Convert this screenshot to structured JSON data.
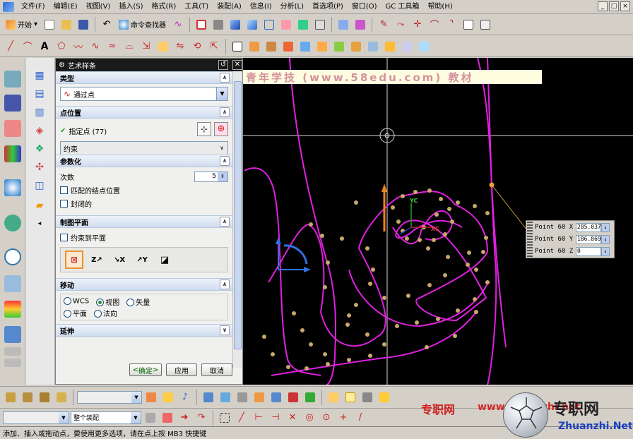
{
  "menubar": {
    "items": [
      "文件(F)",
      "编辑(E)",
      "视图(V)",
      "插入(S)",
      "格式(R)",
      "工具(T)",
      "装配(A)",
      "信息(I)",
      "分析(L)",
      "首选项(P)",
      "窗口(O)",
      "GC 工具箱",
      "帮助(H)"
    ],
    "window_buttons": [
      "_",
      "□",
      "×"
    ]
  },
  "toolbar1": {
    "start_label": "开始",
    "command_finder_label": "命令查找器"
  },
  "dialog": {
    "title": "艺术样条",
    "type": {
      "header": "类型",
      "value": "通过点"
    },
    "point_position": {
      "header": "点位置",
      "specify_point_label": "指定点 (77)",
      "constraint_label": "约束"
    },
    "parameterization": {
      "header": "参数化",
      "degree_label": "次数",
      "degree_value": "5",
      "match_knots_label": "匹配的结点位置",
      "closed_label": "封闭的"
    },
    "drawing_plane": {
      "header": "制图平面",
      "constrain_to_plane_label": "约束到平面"
    },
    "move": {
      "header": "移动",
      "options": [
        "WCS",
        "视图",
        "矢量",
        "平面",
        "法向"
      ],
      "selected": "视图"
    },
    "extension": {
      "header": "延伸"
    },
    "ok_label": "确定",
    "apply_label": "应用",
    "cancel_label": "取消"
  },
  "viewport": {
    "banner_text": "青年学技 (www.58edu.com) 教材",
    "axis_labels": {
      "yc": "YC",
      "xc": "XC"
    },
    "point_readout": [
      {
        "label": "Point 60 X",
        "value": "285.037"
      },
      {
        "label": "Point 60 Y",
        "value": "186.869"
      },
      {
        "label": "Point 60 Z",
        "value": "0"
      }
    ]
  },
  "bottombar": {
    "assembly_select": "整个装配"
  },
  "status": {
    "text": "添加、插入或拖动点，要使用更多选项，请在点上按 MB3 快捷键"
  },
  "watermark": {
    "text1": "专职网",
    "text2": "www.zhuanzhi.net",
    "text3": "专职网",
    "text4": "Zhuanzhi.Net"
  },
  "colors": {
    "curve": "#e020e0",
    "point": "#c8a86a",
    "background": "#000000",
    "accent": "#2a6ad8"
  }
}
